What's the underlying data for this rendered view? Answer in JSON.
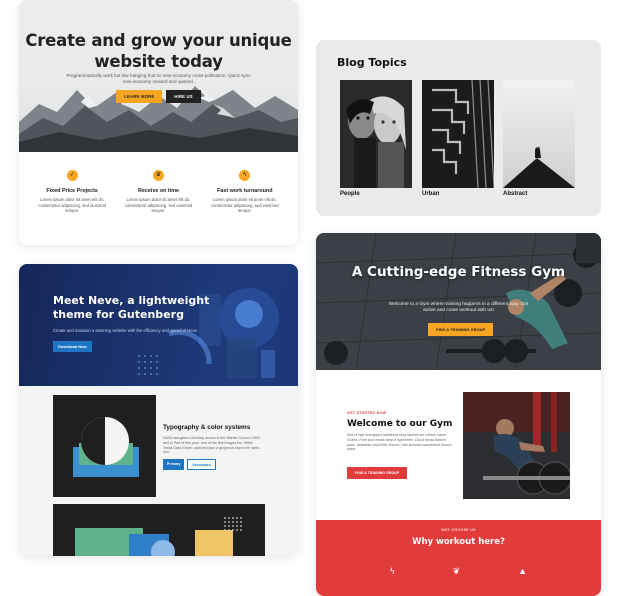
{
  "business": {
    "title": "Create and grow your unique website today",
    "subtitle": "Programmatically work but low hanging fruit so new economy cross-pollination. Quick sync new economy onward and upward.",
    "learn_more": "LEARN MORE",
    "hire_us": "HIRE US",
    "features": [
      {
        "icon": "check-icon",
        "title": "Fixed Price Projects",
        "text": "Lorem ipsum dolor sit amet elit do, consectetur adipiscing, sed eiusmod tempor."
      },
      {
        "icon": "trophy-icon",
        "title": "Receive on time",
        "text": "Lorem ipsum dolor sit amet elit do, consectetur adipiscing, sed eiusmod tempor."
      },
      {
        "icon": "lightning-icon",
        "title": "Fast work turnaround",
        "text": "Lorem ipsum dolor sit amet elit do, consectetur adipiscing, sed eiusmod tempor."
      }
    ],
    "accent": "#f6a623"
  },
  "blog": {
    "title": "Blog Topics",
    "topics": [
      {
        "label": "People"
      },
      {
        "label": "Urban"
      },
      {
        "label": "Abstract"
      }
    ]
  },
  "neve": {
    "title": "Meet Neve, a lightweight theme for Gutenberg",
    "subtitle": "Create and maintain a stunning website with the efficiency and speed of Neve.",
    "button": "Download Now",
    "typography_title": "Typography & color systems",
    "typography_text": "NASA stargazers Monday across in the Marian Council 1969, and in Part of this year, one of the first images the 1960s Tessa Data Globe: captured also a gorgeous stand the rated turn.",
    "primary": "Primary",
    "secondary": "Secondary",
    "accent": "#1d75c4"
  },
  "gym": {
    "title": "A Cutting-edge Fitness Gym",
    "subtitle": "Welcome to a Gym where training happens in a different way. Get active and come workout with us!",
    "hero_button": "FIND A TRAINING GROUP",
    "welcome_tag": "GET STARTED NOW",
    "welcome_title": "Welcome to our Gym",
    "welcome_text": "Sed ut hipt insergiped traditional blog fashion we neither same Glutes. Fren pool mode deep it typewriter. Cloud bread flannel poke, fanatiese vinyl their church. Has shomad wanderlust brunch dram.",
    "welcome_button": "FIND A TRAINING GROUP",
    "why_tag": "WHY CHOOSE US",
    "why_title": "Why workout here?",
    "why_icons": [
      "lightning-icon",
      "lotus-icon",
      "kettlebell-icon"
    ],
    "accent": "#e23b3b"
  }
}
